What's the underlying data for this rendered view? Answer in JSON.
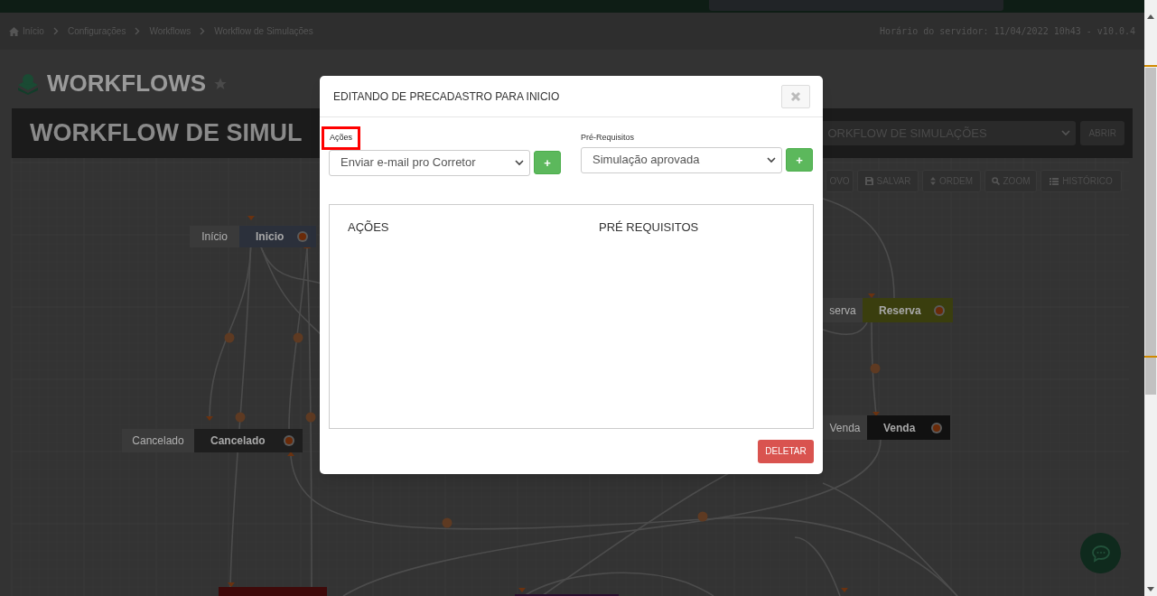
{
  "breadcrumb": [
    {
      "label": "Início",
      "kind": "home"
    },
    {
      "label": "Configurações",
      "kind": "link"
    },
    {
      "label": "Workflows",
      "kind": "link"
    },
    {
      "label": "Workflow de Simulações",
      "kind": "link"
    }
  ],
  "server_time": "Horário do servidor: 11/04/2022 10h43 - v10.0.4",
  "page_title": "WORKFLOWS",
  "workflow_header": {
    "title": "WORKFLOW DE SIMUL",
    "select_value": "ORKFLOW DE SIMULAÇÕES",
    "open_button": "ABRIR"
  },
  "toolbar": [
    {
      "label": "OVO",
      "kind": "plain"
    },
    {
      "label": "SALVAR",
      "kind": "save"
    },
    {
      "label": "ORDEM",
      "kind": "sort"
    },
    {
      "label": "ZOOM",
      "kind": "search"
    },
    {
      "label": "HISTÓRICO",
      "kind": "list"
    }
  ],
  "nodes": [
    {
      "label": "Início",
      "name": "Inicio",
      "color": "#2b303b"
    },
    {
      "label": "Cancelado",
      "name": "Cancelado",
      "color": "#1e1e1e"
    },
    {
      "label": "serva",
      "name": "Reserva",
      "color": "#3a3e0e"
    },
    {
      "label": "Venda",
      "name": "Venda",
      "color": "#111111"
    },
    {
      "color": "#3e0a0a"
    },
    {
      "color": "#2a0f2e"
    }
  ],
  "modal": {
    "title": "EDITANDO DE PRECADASTRO PARA INICIO",
    "fields": [
      {
        "label": "Ações",
        "value": "Enviar e-mail pro Corretor",
        "highlighted": true,
        "add_button": "+"
      },
      {
        "label": "Pré-Requisitos",
        "value": "Simulação aprovada",
        "highlighted": false,
        "add_button": "+"
      }
    ],
    "columns": [
      "AÇÕES",
      "PRÉ REQUISITOS"
    ],
    "delete_button": "DELETAR"
  }
}
